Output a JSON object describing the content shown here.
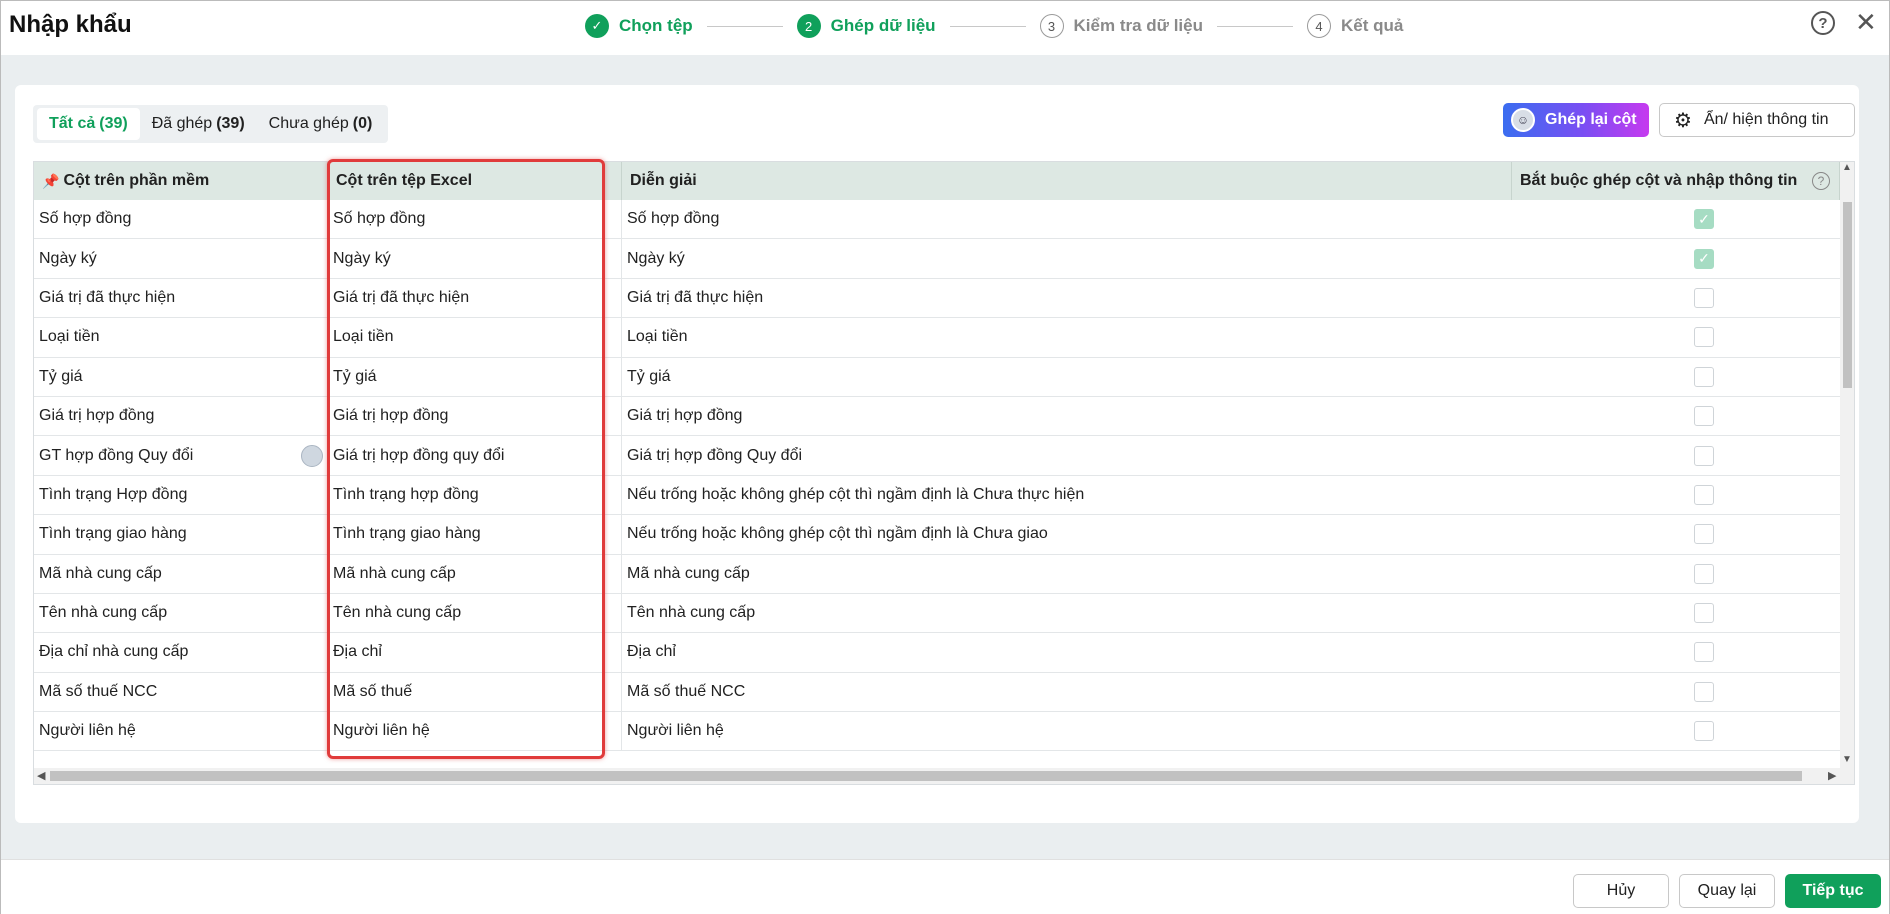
{
  "app": {
    "title": "Nhập khẩu"
  },
  "stepper": [
    {
      "number": "✓",
      "label": "Chọn tệp",
      "state": "done"
    },
    {
      "number": "2",
      "label": "Ghép dữ liệu",
      "state": "active"
    },
    {
      "number": "3",
      "label": "Kiểm tra dữ liệu",
      "state": "todo"
    },
    {
      "number": "4",
      "label": "Kết quả",
      "state": "todo"
    }
  ],
  "tabs": [
    {
      "label": "Tất cả",
      "count": "(39)"
    },
    {
      "label": "Đã ghép",
      "count": "(39)"
    },
    {
      "label": "Chưa ghép",
      "count": "(0)"
    }
  ],
  "toolbar": {
    "regroup_label": "Ghép lại cột",
    "showhide_label": "Ẩn/ hiện thông tin"
  },
  "table": {
    "headers": [
      "Cột trên phần mềm",
      "Cột trên tệp Excel",
      "Diễn giải",
      "Bắt buộc ghép cột và nhập thông tin"
    ],
    "rows": [
      {
        "software": "Số hợp đồng",
        "excel": "Số hợp đồng",
        "desc": "Số hợp đồng",
        "required": true
      },
      {
        "software": "Ngày ký",
        "excel": "Ngày ký",
        "desc": "Ngày ký",
        "required": true
      },
      {
        "software": "Giá trị đã thực hiện",
        "excel": "Giá trị đã thực hiện",
        "desc": "Giá trị đã thực hiện",
        "required": false
      },
      {
        "software": "Loại tiền",
        "excel": "Loại tiền",
        "desc": "Loại tiền",
        "required": false
      },
      {
        "software": "Tỷ giá",
        "excel": "Tỷ giá",
        "desc": "Tỷ giá",
        "required": false
      },
      {
        "software": "Giá trị hợp đồng",
        "excel": "Giá trị hợp đồng",
        "desc": "Giá trị hợp đồng",
        "required": false
      },
      {
        "software": "GT hợp đồng Quy đổi",
        "excel": "Giá trị hợp đồng quy đổi",
        "desc": "Giá trị hợp đồng Quy đổi",
        "required": false
      },
      {
        "software": "Tình trạng Hợp đồng",
        "excel": "Tình trạng hợp đồng",
        "desc": "Nếu trống hoặc không ghép cột thì ngầm định là Chưa thực hiện",
        "required": false
      },
      {
        "software": "Tình trạng giao hàng",
        "excel": "Tình trạng giao hàng",
        "desc": "Nếu trống hoặc không ghép cột thì ngầm định là Chưa giao",
        "required": false
      },
      {
        "software": "Mã nhà cung cấp",
        "excel": "Mã nhà cung cấp",
        "desc": "Mã nhà cung cấp",
        "required": false
      },
      {
        "software": "Tên nhà cung cấp",
        "excel": "Tên nhà cung cấp",
        "desc": "Tên nhà cung cấp",
        "required": false
      },
      {
        "software": "Địa chỉ nhà cung cấp",
        "excel": "Địa chỉ",
        "desc": "Địa chỉ",
        "required": false
      },
      {
        "software": "Mã số thuế NCC",
        "excel": "Mã số thuế",
        "desc": "Mã số thuế NCC",
        "required": false
      },
      {
        "software": "Người liên hệ",
        "excel": "Người liên hệ",
        "desc": "Người liên hệ",
        "required": false
      }
    ]
  },
  "footer": {
    "cancel_label": "Hủy",
    "back_label": "Quay lại",
    "next_label": "Tiếp tục"
  },
  "colors": {
    "accent": "#10a05b",
    "highlight": "#e03b3b"
  }
}
